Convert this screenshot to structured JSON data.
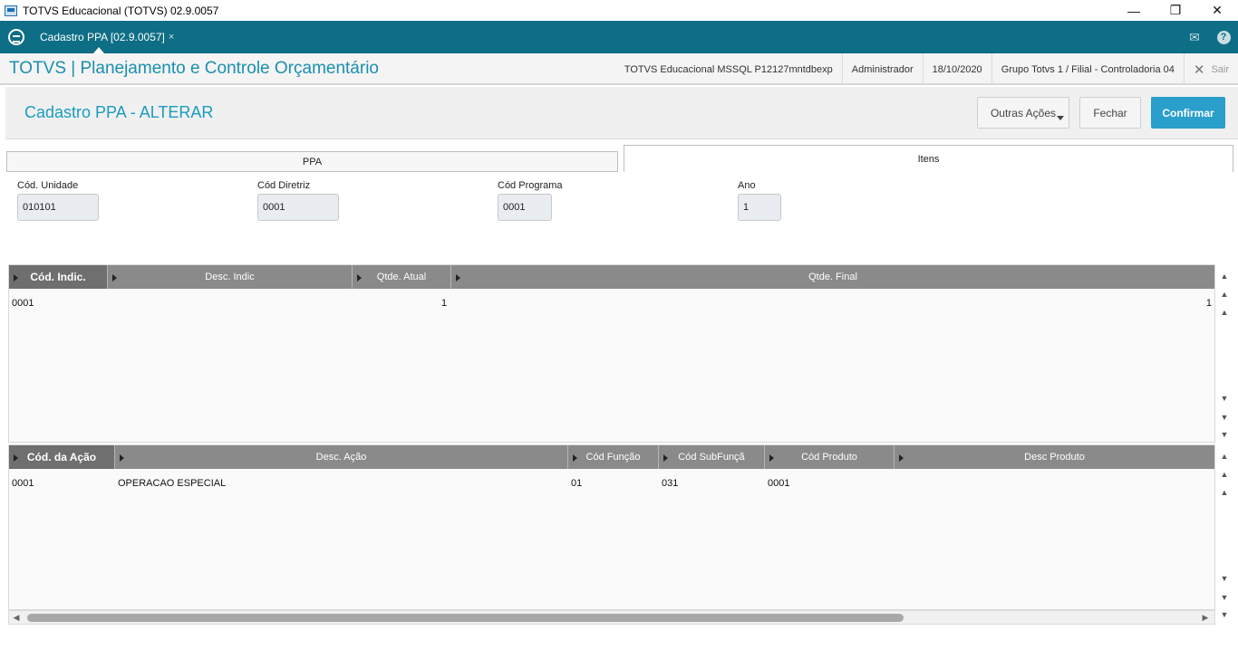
{
  "window": {
    "title": "TOTVS Educacional (TOTVS) 02.9.0057",
    "minimize": "—",
    "maximize": "❐",
    "close": "✕"
  },
  "tabstrip": {
    "tab_label": "Cadastro PPA [02.9.0057]",
    "tab_close": "×",
    "mail_icon": "✉",
    "help_icon": "?"
  },
  "header": {
    "app_name": "TOTVS | Planejamento e Controle Orçamentário",
    "environment": "TOTVS Educacional MSSQL P12127mntdbexp",
    "user": "Administrador",
    "date": "18/10/2020",
    "company": "Grupo Totvs 1 / Filial - Controladoria 04",
    "exit_label": "Sair"
  },
  "form": {
    "title": "Cadastro PPA - ALTERAR",
    "buttons": {
      "outras": "Outras Ações",
      "fechar": "Fechar",
      "confirmar": "Confirmar"
    },
    "tabs": [
      "PPA",
      "Itens"
    ],
    "fields": {
      "unidade": {
        "label": "Cód. Unidade",
        "value": "010101"
      },
      "diretriz": {
        "label": "Cód Diretriz",
        "value": "0001"
      },
      "programa": {
        "label": "Cód Programa",
        "value": "0001"
      },
      "ano": {
        "label": "Ano",
        "value": "1"
      }
    }
  },
  "grid1": {
    "columns": [
      "Cód. Indic.",
      "Desc. Indic",
      "Qtde. Atual",
      "Qtde. Final"
    ],
    "rows": [
      {
        "cod": "0001",
        "desc": "",
        "atual": "1",
        "final": "1"
      }
    ]
  },
  "grid2": {
    "columns": [
      "Cód. da Ação",
      "Desc. Ação",
      "Cód Função",
      "Cód SubFunçã",
      "Cód Produto",
      "Desc Produto"
    ],
    "rows": [
      {
        "cod": "0001",
        "desc": "OPERACAO ESPECIAL",
        "funcao": "01",
        "subfuncao": "031",
        "produto": "0001",
        "desc_produto": ""
      }
    ]
  },
  "scroll": {
    "top": "▲",
    "up": "▲",
    "down": "▼",
    "bottom": "▼",
    "left": "◀",
    "right": "▶"
  },
  "colors": {
    "accent": "#0e6e86",
    "title_blue": "#1a8fb0",
    "confirm": "#2a9fcb",
    "grid_header": "#8a8a8a"
  }
}
